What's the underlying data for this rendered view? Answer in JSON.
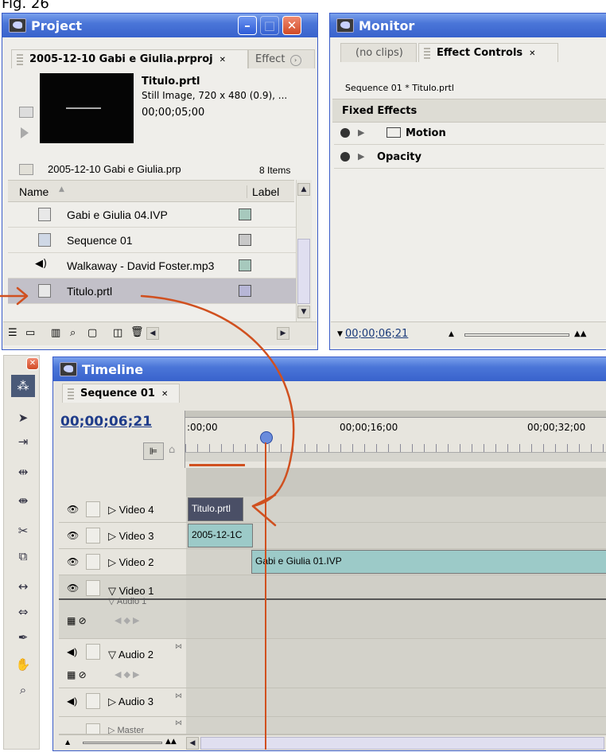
{
  "caption": "Fig. 26",
  "colors": {
    "titlebar": "#3862cc",
    "panel": "#efeeea",
    "selection": "#c2c0c8",
    "annotation": "#d0501f",
    "clip_video4": "#4a4f66",
    "clip_audio": "#9ccac8",
    "label_teal": "#a7c9bd",
    "label_gray": "#c8c8c8",
    "label_lavender": "#b7b6d6"
  },
  "project": {
    "title": "Project",
    "tab_active": "2005-12-10 Gabi e Giulia.prproj",
    "tab_inactive": "Effect",
    "preview": {
      "name": "Titulo.prtl",
      "info": "Still Image, 720 x 480 (0.9), ...",
      "duration": "00;00;05;00"
    },
    "bin": {
      "name": "2005-12-10 Gabi e Giulia.prp",
      "count": "8 Items"
    },
    "columns": {
      "name": "Name",
      "label": "Label"
    },
    "items": [
      {
        "name": "Gabi e Giulia 04.IVP",
        "icon": "video-file-icon",
        "label_color": "#a7c9bd"
      },
      {
        "name": "Sequence 01",
        "icon": "sequence-icon",
        "label_color": "#c8c8c8"
      },
      {
        "name": "Walkaway - David Foster.mp3",
        "icon": "audio-file-icon",
        "label_color": "#a7c9bd"
      },
      {
        "name": "Titulo.prtl",
        "icon": "title-file-icon",
        "label_color": "#b7b6d6"
      }
    ]
  },
  "monitor": {
    "title": "Monitor",
    "tab_clips": "(no clips)",
    "tab_effects": "Effect Controls",
    "sequence_label": "Sequence 01 * Titulo.prtl",
    "section": "Fixed Effects",
    "effects": [
      "Motion",
      "Opacity"
    ],
    "timecode": "00;00;06;21"
  },
  "timeline": {
    "title": "Timeline",
    "tab": "Sequence 01",
    "timecode": "00;00;06;21",
    "ruler_labels": [
      ":00;00",
      "00;00;16;00",
      "00;00;32;00"
    ],
    "tracks": [
      {
        "name": "Video 4",
        "clip": "Titulo.prtl"
      },
      {
        "name": "Video 3",
        "clip": "2005-12-1C"
      },
      {
        "name": "Video 2",
        "clip": "Gabi e Giulia 01.IVP"
      },
      {
        "name": "Video 1"
      },
      {
        "name": "Audio 1"
      },
      {
        "name": "Audio 2"
      },
      {
        "name": "Audio 3"
      },
      {
        "name": "Master"
      }
    ]
  }
}
